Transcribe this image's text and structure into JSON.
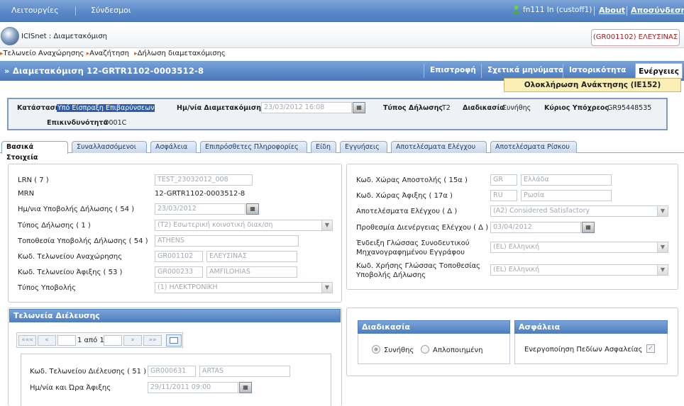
{
  "topbar": {
    "menu_functions": "Λειτουργίες",
    "menu_links": "Σύνδεσμοι",
    "user": "fn111 In (custoff1)",
    "about": "About",
    "logout": "Αποσύνδεση"
  },
  "header": {
    "app_title": "ICISnet : Διαμετακόμιση",
    "office": "(GR001102) ΕΛΕΥΣΙΝΑΣ"
  },
  "breadcrumb": [
    "Τελωνείο Αναχώρησης",
    "Αναζήτηση",
    "Δήλωση διαμετακόμισης"
  ],
  "titlebar": {
    "title": "» Διαμετακόμιση 12-GRTR1102-0003512-8",
    "btn_back": "Επιστροφή",
    "btn_messages": "Σχετικά μηνύματα",
    "btn_history": "Ιστορικότητα",
    "btn_actions": "Ενέργειες",
    "dropdown_item": "Ολοκλήρωση Ανάκτησης (IE152)"
  },
  "info": {
    "status_label": "Κατάσταση",
    "status_value": "Υπό Είσπραξη Επιβαρύνσεων",
    "date_label": "Ημ/νία Διαμετακόμισης",
    "date_value": "23/03/2012 16:08",
    "type_label": "Τύπος Δήλωσης",
    "type_value": "T2",
    "proc_label": "Διαδικασία",
    "proc_value": "Συνήθης",
    "obligor_label": "Κύριος Υπόχρεος",
    "obligor_value": "GR95448535",
    "danger_label": "Επικινδυνότητα",
    "danger_value": "O001C"
  },
  "tabs": [
    "Βασικά Στοιχεία",
    "Συναλλασσόμενοι",
    "Ασφάλεια",
    "Επιπρόσθετες Πληροφορίες",
    "Είδη",
    "Εγγυήσεις",
    "Αποτελέσματα Ελέγχου",
    "Αποτελέσματα Ρίσκου"
  ],
  "left": {
    "lrn_label": "LRN ( 7 )",
    "lrn_value": "TEST_23032012_008",
    "mrn_label": "MRN",
    "mrn_value": "12-GRTR1102-0003512-8",
    "subdate_label": "Ημ/νια Υποβολής Δήλωσης ( 54 )",
    "subdate_value": "23/03/2012",
    "dtype_label": "Τύπος Δήλωσης ( 1 )",
    "dtype_value": "(T2) Εσωτερική κοινοτική διακ/ση",
    "place_label": "Τοποθεσία Υποβολής Δήλωσης ( 54 )",
    "place_value": "ATHENS",
    "dep_label": "Κωδ. Τελωνείου Αναχώρησης",
    "dep_code": "GR001102",
    "dep_name": "ΕΛΕΥΣΙΝΑΣ",
    "arr_label": "Κωδ. Τελωνείου Άφιξης ( 53 )",
    "arr_code": "GR000233",
    "arr_name": "AMFILOHIAS",
    "subtype_label": "Τύπος Υποβολής",
    "subtype_value": "(1) ΗΛΕΚΤΡΟΝΙΚΗ"
  },
  "right": {
    "send_label": "Κωδ. Χώρας Αποστολής ( 15α )",
    "send_code": "GR",
    "send_name": "Ελλάδα",
    "dest_label": "Κωδ. Χώρας Άφιξης ( 17α )",
    "dest_code": "RU",
    "dest_name": "Ρωσία",
    "ctrl_label": "Αποτελέσματα Ελέγχου ( Δ )",
    "ctrl_value": "(A2) Considered Satisfactory",
    "deadline_label": "Προθεσμία Διενέργειας Ελέγχου ( Δ )",
    "deadline_value": "03/04/2012",
    "lang_doc_label1": "Ένδειξη Γλώσσας Συνοδευτικού",
    "lang_doc_label2": "Μηχανογραφημένου Εγγράφου",
    "lang_doc_value": "(EL) Ελληνική",
    "lang_place_label1": "Κωδ. Χρήσης Γλώσσας Τοποθεσίας",
    "lang_place_label2": "Υποβολής Δήλωσης",
    "lang_place_value": "(EL) Ελληνική"
  },
  "transit": {
    "header": "Τελωνεία Διέλευσης",
    "pager": {
      "first": "«««",
      "prev": "«",
      "info": "1 από 1",
      "next": "»",
      "last": "»»"
    },
    "office_label": "Κωδ. Τελωνείου Διέλευσης ( 51 )",
    "office_code": "GR000631",
    "office_name": "ARTAS",
    "arrival_label": "Ημ/νία και Ώρα Άφιξης",
    "arrival_value": "29/11/2011 09:00"
  },
  "procedure": {
    "header": "Διαδικασία",
    "opt_normal": "Συνήθης",
    "opt_simplified": "Απλοποιημένη"
  },
  "security": {
    "header": "Ασφάλεια",
    "enable_label": "Ενεργοποίηση Πεδίων Ασφαλείας"
  }
}
